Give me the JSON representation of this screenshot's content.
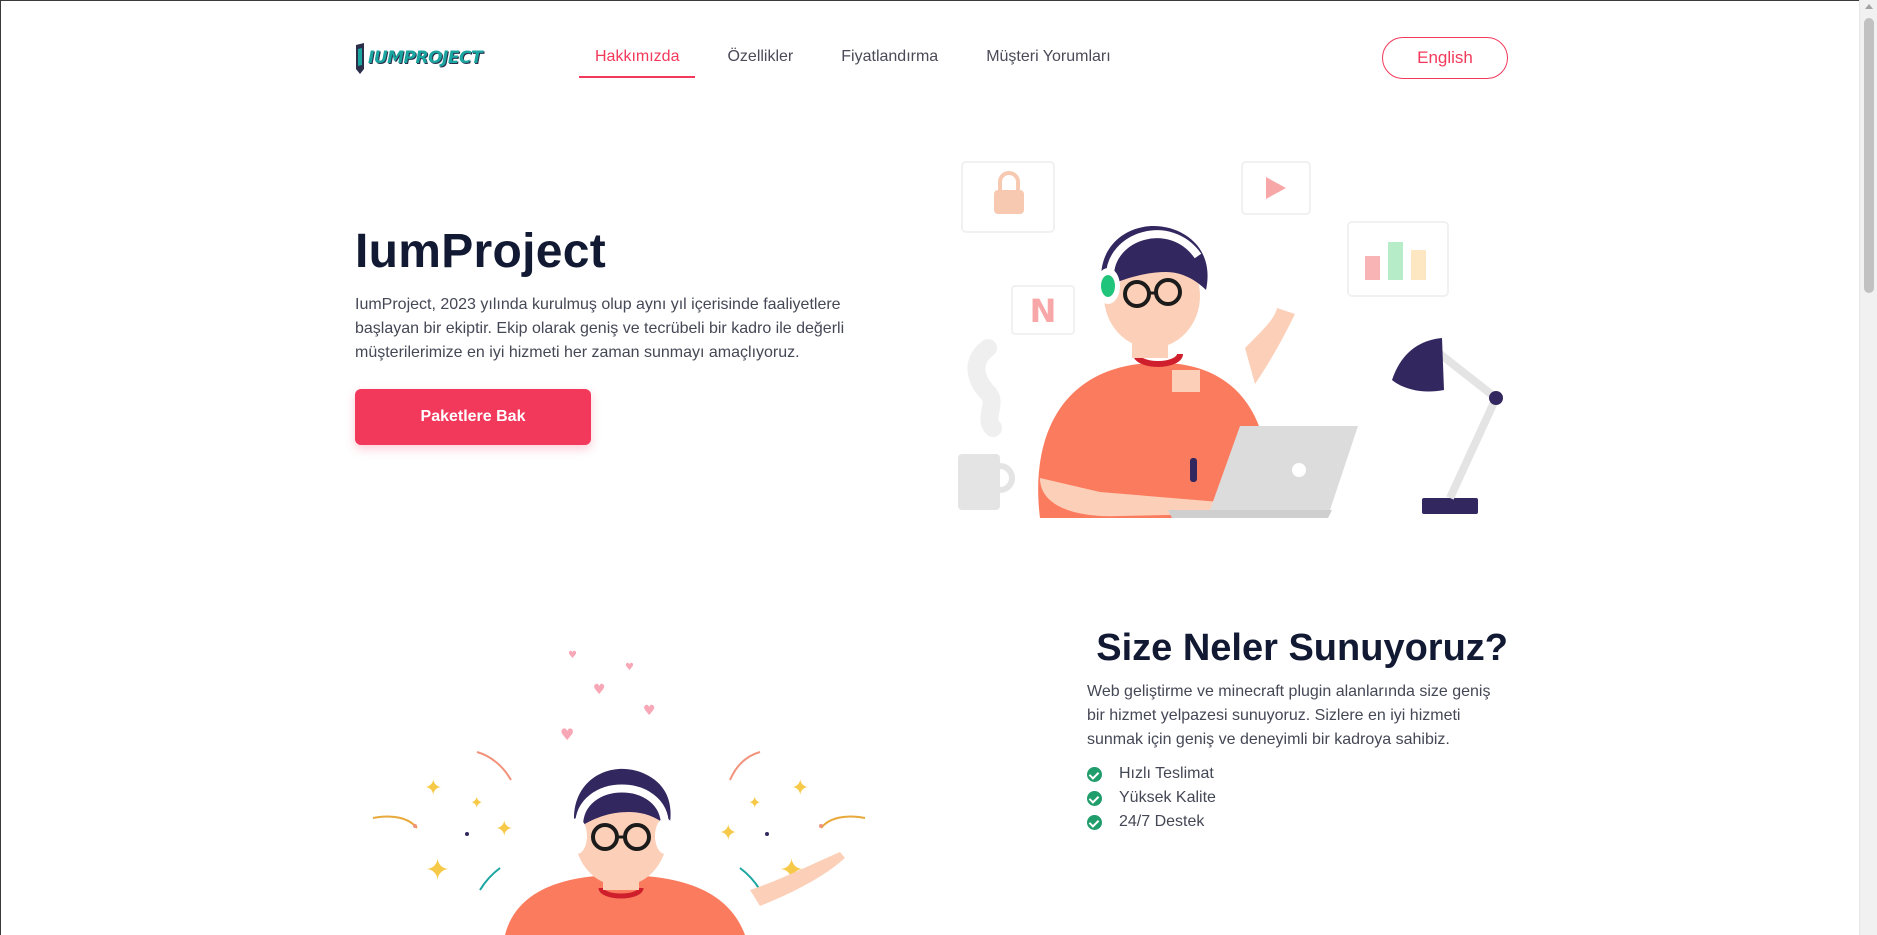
{
  "brand": {
    "logo_text": "IUMPROJECT",
    "accent_color": "#f2395b",
    "logo_color": "#1aa5a0"
  },
  "nav": {
    "items": [
      {
        "label": "Hakkımızda",
        "active": true
      },
      {
        "label": "Özellikler",
        "active": false
      },
      {
        "label": "Fiyatlandırma",
        "active": false
      },
      {
        "label": "Müşteri Yorumları",
        "active": false
      }
    ],
    "language_button": "English"
  },
  "hero": {
    "title": "IumProject",
    "description": "IumProject, 2023 yılında kurulmuş olup aynı yıl içerisinde faaliyetlere başlayan bir ekiptir. Ekip olarak geniş ve tecrübeli bir kadro ile değerli müşterilerimize en iyi hizmeti her zaman sunmayı amaçlıyoruz.",
    "cta_label": "Paketlere Bak",
    "illustration": "person-working-on-laptop-illustration"
  },
  "offer": {
    "title": "Size Neler Sunuyoruz?",
    "description": "Web geliştirme ve minecraft plugin alanlarında size geniş bir hizmet yelpazesi sunuyoruz. Sizlere en iyi hizmeti sunmak için geniş ve deneyimli bir kadroya sahibiz.",
    "features": [
      "Hızlı Teslimat",
      "Yüksek Kalite",
      "24/7 Destek"
    ],
    "illustration": "happy-person-celebrating-illustration"
  }
}
